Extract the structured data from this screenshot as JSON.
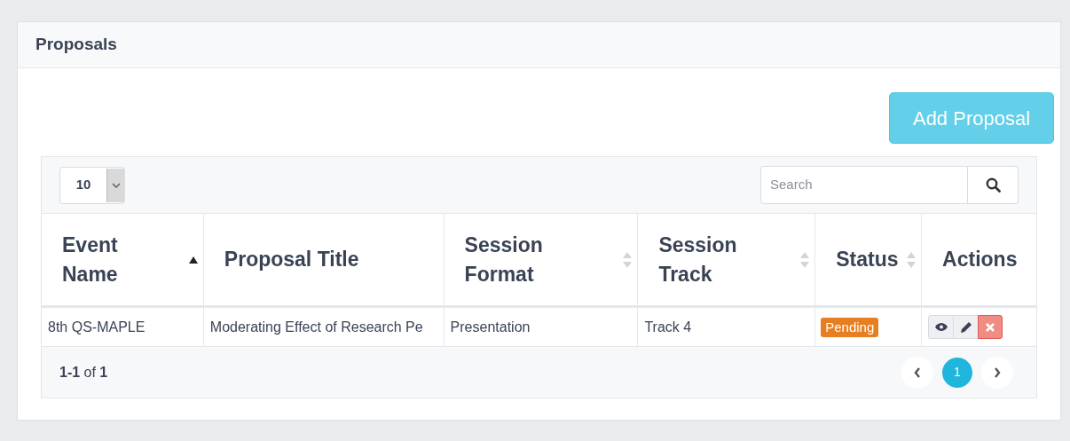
{
  "card": {
    "title": "Proposals"
  },
  "add_button": {
    "label": "Add Proposal"
  },
  "page_size": {
    "value": "10"
  },
  "search": {
    "placeholder": "Search"
  },
  "table": {
    "columns": [
      {
        "label": "Event Name",
        "sortable": true,
        "sorted": true
      },
      {
        "label": "Proposal Title",
        "sortable": false
      },
      {
        "label": "Session Format",
        "sortable": true,
        "sorted": false
      },
      {
        "label": "Session Track",
        "sortable": true,
        "sorted": false
      },
      {
        "label": "Status",
        "sortable": true,
        "sorted": false
      },
      {
        "label": "Actions",
        "sortable": false
      }
    ],
    "rows": [
      {
        "event": "8th QS-MAPLE",
        "title": "Moderating Effect of Research Pe",
        "format": "Presentation",
        "track": "Track 4",
        "status": "Pending",
        "color": "#e67e22"
      }
    ]
  },
  "footer": {
    "summary": "**1-1** of **1**",
    "pages": [
      {
        "label": "1",
        "selected": true
      }
    ]
  }
}
